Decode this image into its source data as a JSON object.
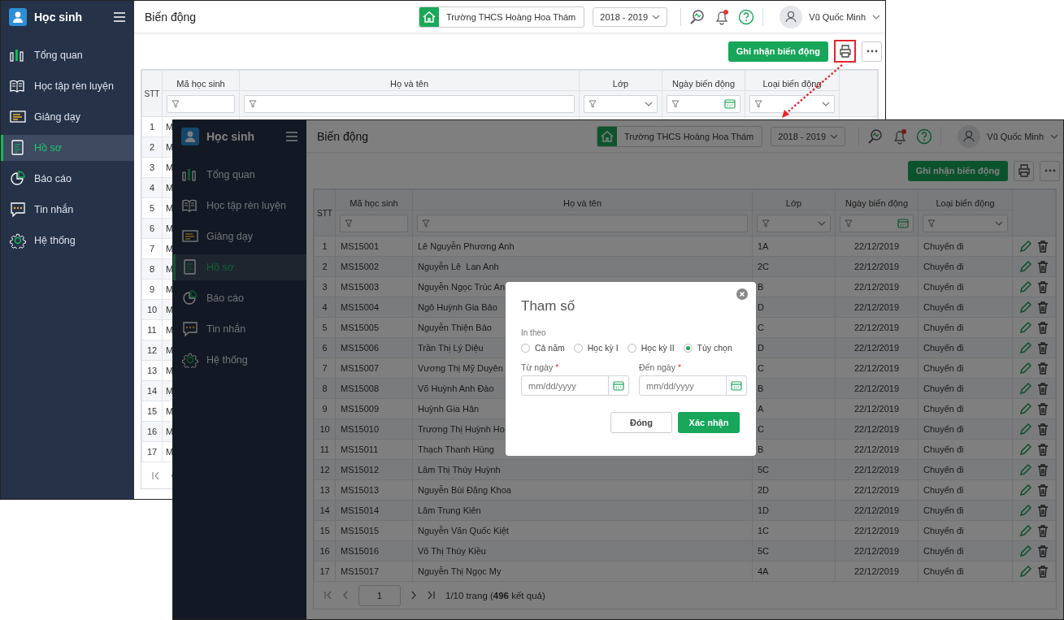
{
  "windows": [
    {
      "kind": "back",
      "app_title": "Học sinh",
      "sidebar": [
        {
          "label": "Tổng quan",
          "selected": false
        },
        {
          "label": "Học tập rèn luyện",
          "selected": false
        },
        {
          "label": "Giảng dạy",
          "selected": false
        },
        {
          "label": "Hồ sơ",
          "selected": true
        },
        {
          "label": "Báo cáo",
          "selected": false
        },
        {
          "label": "Tin nhắn",
          "selected": false
        },
        {
          "label": "Hệ thống",
          "selected": false
        }
      ],
      "page_title": "Biến động",
      "school": "Trường THCS Hoàng Hoa Thám",
      "year": "2018 - 2019",
      "user": "Vũ Quốc Minh",
      "record_button": "Ghi nhận biến động",
      "print_highlighted": true,
      "row_actions": false,
      "columns": [
        {
          "label": "STT",
          "kind": "none"
        },
        {
          "label": "Mã học sinh",
          "kind": "text"
        },
        {
          "label": "Họ và tên",
          "kind": "text"
        },
        {
          "label": "Lớp",
          "kind": "select"
        },
        {
          "label": "Ngày biến động",
          "kind": "date"
        },
        {
          "label": "Loại biến động",
          "kind": "select"
        }
      ],
      "rows": [
        {
          "cells": [
            "1",
            "M"
          ]
        },
        {
          "cells": [
            "2",
            "M"
          ]
        },
        {
          "cells": [
            "3",
            "M"
          ]
        },
        {
          "cells": [
            "4",
            "M"
          ]
        },
        {
          "cells": [
            "5",
            "M"
          ]
        },
        {
          "cells": [
            "6",
            "M"
          ]
        },
        {
          "cells": [
            "7",
            "M"
          ]
        },
        {
          "cells": [
            "8",
            "M"
          ]
        },
        {
          "cells": [
            "9",
            "M"
          ]
        },
        {
          "cells": [
            "10",
            "M"
          ]
        },
        {
          "cells": [
            "11",
            "M"
          ]
        },
        {
          "cells": [
            "12",
            "M"
          ]
        },
        {
          "cells": [
            "13",
            "M"
          ]
        },
        {
          "cells": [
            "14",
            "M"
          ]
        },
        {
          "cells": [
            "15",
            "M"
          ]
        },
        {
          "cells": [
            "16",
            "M"
          ]
        },
        {
          "cells": [
            "17",
            "M"
          ]
        }
      ]
    },
    {
      "kind": "front",
      "dimmed": true,
      "app_title": "Học sinh",
      "sidebar": [
        {
          "label": "Tổng quan",
          "selected": false
        },
        {
          "label": "Học tập rèn luyện",
          "selected": false
        },
        {
          "label": "Giảng dạy",
          "selected": false
        },
        {
          "label": "Hồ sơ",
          "selected": true
        },
        {
          "label": "Báo cáo",
          "selected": false
        },
        {
          "label": "Tin nhắn",
          "selected": false
        },
        {
          "label": "Hệ thống",
          "selected": false
        }
      ],
      "page_title": "Biến động",
      "school": "Trường THCS Hoàng Hoa Thám",
      "year": "2018 - 2019",
      "user": "Vũ Quốc Minh",
      "record_button": "Ghi nhận biến động",
      "print_highlighted": false,
      "row_actions": true,
      "columns": [
        {
          "label": "STT",
          "kind": "none"
        },
        {
          "label": "Mã học sinh",
          "kind": "text"
        },
        {
          "label": "Họ và tên",
          "kind": "text"
        },
        {
          "label": "Lớp",
          "kind": "select"
        },
        {
          "label": "Ngày biến động",
          "kind": "date"
        },
        {
          "label": "Loại biến động",
          "kind": "select"
        }
      ],
      "rows": [
        {
          "cells": [
            "1",
            "MS15001",
            "Lê Nguyễn Phương Anh",
            "1A",
            "22/12/2019",
            "Chuyển đi"
          ]
        },
        {
          "cells": [
            "2",
            "MS15002",
            "Nguyễn Lê  Lan Anh",
            "2C",
            "22/12/2019",
            "Chuyển đi"
          ]
        },
        {
          "cells": [
            "3",
            "MS15003",
            "Nguyễn Ngọc Trúc An",
            "B",
            "22/12/2019",
            "Chuyển đi"
          ]
        },
        {
          "cells": [
            "4",
            "MS15004",
            "Ngô Huỳnh Gia Bảo",
            "D",
            "22/12/2019",
            "Chuyển đi"
          ]
        },
        {
          "cells": [
            "5",
            "MS15005",
            "Nguyễn Thiện Bảo",
            "C",
            "22/12/2019",
            "Chuyển đi"
          ]
        },
        {
          "cells": [
            "6",
            "MS15006",
            "Trần Thị Lý Diệu",
            "D",
            "22/12/2019",
            "Chuyển đi"
          ]
        },
        {
          "cells": [
            "7",
            "MS15007",
            "Vương Thị Mỹ Duyên",
            "C",
            "22/12/2019",
            "Chuyển đi"
          ]
        },
        {
          "cells": [
            "8",
            "MS15008",
            "Võ Huỳnh Anh Đào",
            "B",
            "22/12/2019",
            "Chuyển đi"
          ]
        },
        {
          "cells": [
            "9",
            "MS15009",
            "Huỳnh Gia Hân",
            "A",
            "22/12/2019",
            "Chuyển đi"
          ]
        },
        {
          "cells": [
            "10",
            "MS15010",
            "Trương Thị Huỳnh Ho",
            "C",
            "22/12/2019",
            "Chuyển đi"
          ]
        },
        {
          "cells": [
            "11",
            "MS15011",
            "Thạch Thanh Hùng",
            "B",
            "22/12/2019",
            "Chuyển đi"
          ]
        },
        {
          "cells": [
            "12",
            "MS15012",
            "Lâm Thị Thúy Huỳnh",
            "5C",
            "22/12/2019",
            "Chuyển đi"
          ]
        },
        {
          "cells": [
            "13",
            "MS15013",
            "Nguyễn Bùi Đăng Khoa",
            "2D",
            "22/12/2019",
            "Chuyển đi"
          ]
        },
        {
          "cells": [
            "14",
            "MS15014",
            "Lâm Trung Kiên",
            "1D",
            "22/12/2019",
            "Chuyển đi"
          ]
        },
        {
          "cells": [
            "15",
            "MS15015",
            "Nguyễn Văn Quốc Kiệt",
            "1C",
            "22/12/2019",
            "Chuyển đi"
          ]
        },
        {
          "cells": [
            "16",
            "MS15016",
            "Võ Thị Thúy Kiều",
            "5C",
            "22/12/2019",
            "Chuyển đi"
          ]
        },
        {
          "cells": [
            "17",
            "MS15017",
            "Nguyễn Thị Ngọc My",
            "4A",
            "22/12/2019",
            "Chuyển đi"
          ]
        }
      ],
      "pagination": {
        "page": "1",
        "summary": "1/10 trang (**496** kết quả)"
      },
      "dialog": {
        "title": "Tham số",
        "group_label": "In theo",
        "options": [
          {
            "label": "Cả năm",
            "selected": false
          },
          {
            "label": "Học kỳ I",
            "selected": false
          },
          {
            "label": "Học kỳ II",
            "selected": false
          },
          {
            "label": "Tùy chọn",
            "selected": true
          }
        ],
        "fields": [
          {
            "label": "Từ ngày",
            "required_mark": "*",
            "placeholder": "mm/dd/yyyy"
          },
          {
            "label": "Đến ngày",
            "required_mark": "*",
            "placeholder": "mm/dd/yyyy"
          }
        ],
        "buttons": [
          {
            "label": "Đóng",
            "kind": "secondary"
          },
          {
            "label": "Xác nhận",
            "kind": "primary"
          }
        ]
      }
    }
  ]
}
